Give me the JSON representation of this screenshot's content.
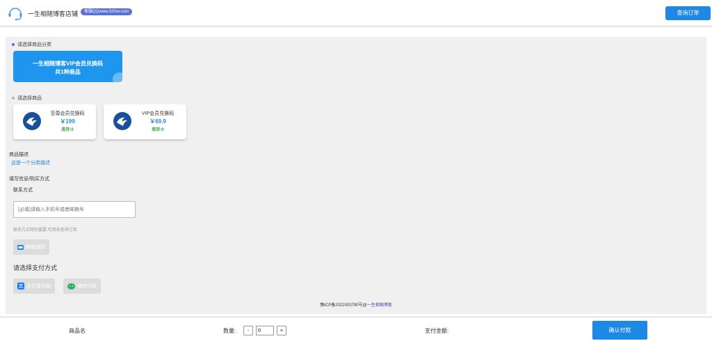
{
  "header": {
    "shop_name": "一生相随博客店铺",
    "qq_badge": "客服QQwww.520xv.com",
    "query_button": "查询订单"
  },
  "category": {
    "section_label": "请选择商品分类",
    "card_name": "一生相随博客VIP会员兑换码",
    "card_count": "共1种商品"
  },
  "goods": {
    "section_label": "请选择商品",
    "items": [
      {
        "name": "至尊会员兑换码",
        "price": "￥199",
        "stock": "库存:0"
      },
      {
        "name": "VIP会员兑换码",
        "price": "￥69.9",
        "stock": "库存:0"
      }
    ]
  },
  "description": {
    "label": "商品描述",
    "text": "这是一个分类描述"
  },
  "form": {
    "section_label": "填写信息/购买方式",
    "contact_label": "联系方式",
    "contact_placeholder": "[必填]请输入手机号或者邮箱号",
    "contact_hint": "联系方式特别重要,可用来查询订单",
    "email_notify": "邮箱通知"
  },
  "payment": {
    "title": "请选择支付方式",
    "alipay": "支付宝付款",
    "wechat": "微信付款"
  },
  "footer": {
    "icp": "豫ICP备2022003790号@",
    "link": "一生相随博客"
  },
  "bottom_bar": {
    "product_label": "商品名",
    "quantity_label": "数量:",
    "minus": "-",
    "plus": "+",
    "quantity_value": "0",
    "amount_label": "支付金额:",
    "confirm_button": "确认付款"
  },
  "colors": {
    "primary": "#1e88e5",
    "category_card": "#1e96f0",
    "stock_green": "#2e9a3a",
    "alipay": "#1677ff",
    "wechat": "#2aae67"
  }
}
